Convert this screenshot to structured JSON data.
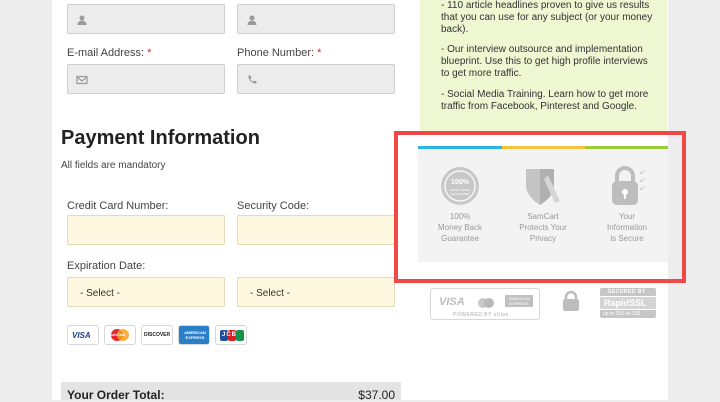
{
  "billing": {
    "email_label": "E-mail Address:",
    "phone_label": "Phone Number:",
    "required_mark": "*"
  },
  "payment": {
    "title": "Payment Information",
    "mandatory_note": "All fields are mandatory",
    "card_number_label": "Credit Card Number:",
    "security_code_label": "Security Code:",
    "expiration_label": "Expiration Date:",
    "month_select": "- Select -",
    "year_select": "- Select -",
    "card_logos": [
      "VISA",
      "MasterCard",
      "DISCOVER",
      "AMERICAN EXPRESS",
      "JCB"
    ]
  },
  "bonuses": [
    "- 110 article headlines proven to give us results that you can use for any subject (or your money back).",
    "- Our interview outsource and implementation blueprint. Use this to get high profile interviews to get more traffic.",
    "- Social Media Training. Learn how to get more traffic from Facebook, Pinterest and Google."
  ],
  "trust": {
    "guarantee_seal": "100% MONEY BACK GUARANTEE",
    "guarantee_line1": "100%",
    "guarantee_line2": "Money Back",
    "guarantee_line3": "Guarantee",
    "privacy_line1": "SamCart",
    "privacy_line2": "Protects Your",
    "privacy_line3": "Privacy",
    "secure_line1": "Your",
    "secure_line2": "Information",
    "secure_line3": "is Secure"
  },
  "security_badges": {
    "stripe_label": "POWERED BY stripe",
    "visa": "VISA",
    "amex": "AMERICAN EXPRESS",
    "rapidssl_top": "SECURED BY",
    "rapidssl_name": "RapidSSL",
    "rapidssl_bottom": "up to 256-bit SSL"
  },
  "order": {
    "total_label": "Your Order Total:",
    "total_value": "$37.00"
  },
  "colors": {
    "trust_bar": [
      "#2ab4e8",
      "#f5c33b",
      "#9bcc3a"
    ],
    "highlight_border": "#f04747"
  }
}
